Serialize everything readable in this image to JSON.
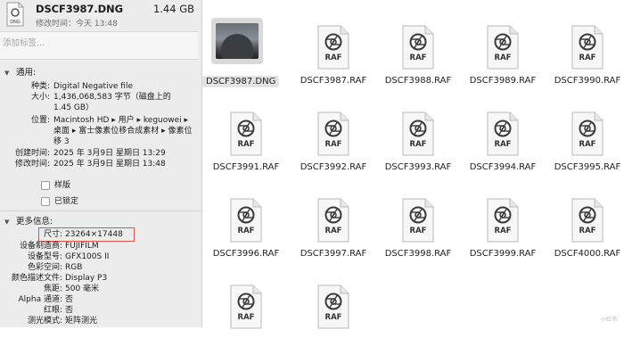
{
  "header": {
    "icon_label": "DNG",
    "filename": "DSCF3987.DNG",
    "size": "1.44 GB",
    "modified": "修改时间：今天 13:48"
  },
  "tags": {
    "placeholder": "添加标签..."
  },
  "general": {
    "title": "通用:",
    "rows": [
      {
        "key": "种类:",
        "value": "Digital Negative file"
      },
      {
        "key": "大小:",
        "value": "1,436,068,583 字节（磁盘上的 1.45 GB）"
      },
      {
        "key": "位置:",
        "value": "Macintosh HD ▸ 用户 ▸ keguowei ▸ 桌面 ▸ 富士像素位移合成素材 ▸ 像素位移 3"
      },
      {
        "key": "创建时间:",
        "value": "2025 年 3月9日 星期日 13:29"
      },
      {
        "key": "修改时间:",
        "value": "2025 年 3月9日 星期日 13:48"
      }
    ],
    "stationery": "样版",
    "locked": "已锁定"
  },
  "more_info": {
    "title": "更多信息:",
    "rows": [
      {
        "key": "尺寸:",
        "value": "23264×17448"
      },
      {
        "key": "设备制造商:",
        "value": "FUJIFILM"
      },
      {
        "key": "设备型号:",
        "value": "GFX100S II"
      },
      {
        "key": "色彩空间:",
        "value": "RGB"
      },
      {
        "key": "颜色描述文件:",
        "value": "Display P3"
      },
      {
        "key": "焦距:",
        "value": "500 毫米"
      },
      {
        "key": "Alpha 通道:",
        "value": "否"
      },
      {
        "key": "红眼:",
        "value": "否"
      },
      {
        "key": "测光模式:",
        "value": "矩阵测光"
      }
    ]
  },
  "files": [
    {
      "name": "DSCF3987.DNG",
      "type": "image",
      "selected": true
    },
    {
      "name": "DSCF3987.RAF",
      "type": "RAF"
    },
    {
      "name": "DSCF3988.RAF",
      "type": "RAF"
    },
    {
      "name": "DSCF3989.RAF",
      "type": "RAF"
    },
    {
      "name": "DSCF3990.RAF",
      "type": "RAF"
    },
    {
      "name": "DSCF3991.RAF",
      "type": "RAF"
    },
    {
      "name": "DSCF3992.RAF",
      "type": "RAF"
    },
    {
      "name": "DSCF3993.RAF",
      "type": "RAF"
    },
    {
      "name": "DSCF3994.RAF",
      "type": "RAF"
    },
    {
      "name": "DSCF3995.RAF",
      "type": "RAF"
    },
    {
      "name": "DSCF3996.RAF",
      "type": "RAF"
    },
    {
      "name": "DSCF3997.RAF",
      "type": "RAF"
    },
    {
      "name": "DSCF3998.RAF",
      "type": "RAF"
    },
    {
      "name": "DSCF3999.RAF",
      "type": "RAF"
    },
    {
      "name": "DSCF4000.RAF",
      "type": "RAF"
    },
    {
      "name": "",
      "type": "RAF"
    },
    {
      "name": "",
      "type": "RAF"
    }
  ],
  "watermark": "小红书"
}
